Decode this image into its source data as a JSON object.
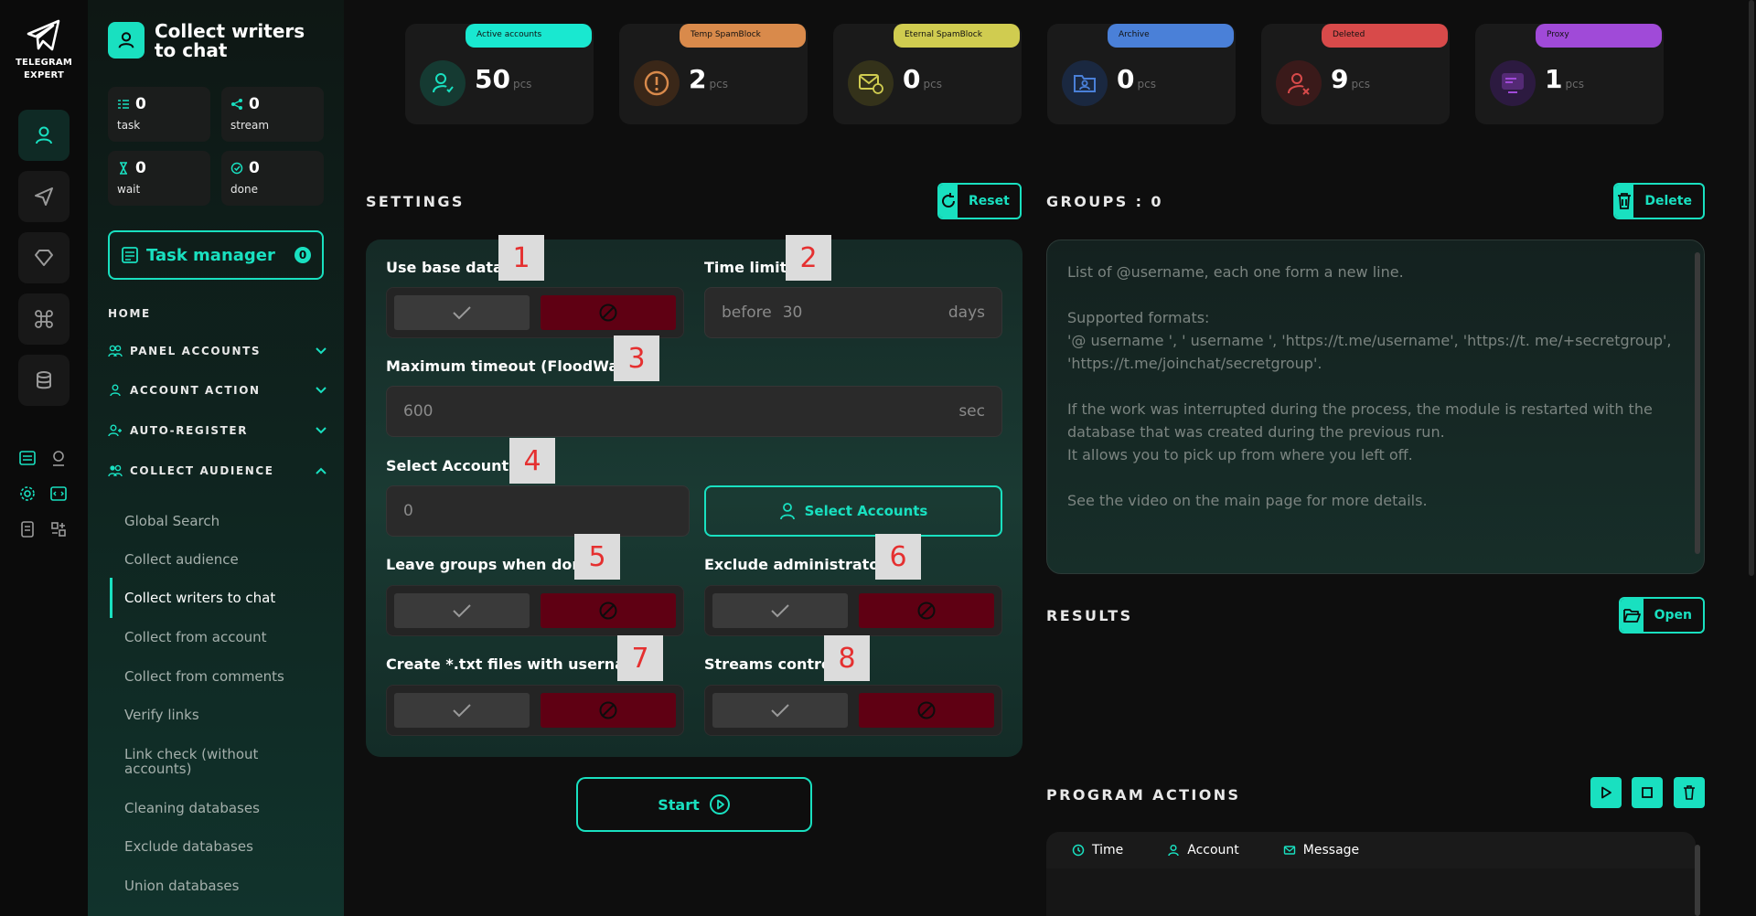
{
  "app": {
    "brand": "TELEGRAM EXPERT",
    "accent": "#19e0c0"
  },
  "sidebar": {
    "title": "Collect writers to chat",
    "stats": [
      {
        "value": "0",
        "label": "task",
        "icon": "task-list-icon"
      },
      {
        "value": "0",
        "label": "stream",
        "icon": "share-icon"
      },
      {
        "value": "0",
        "label": "wait",
        "icon": "hourglass-icon"
      },
      {
        "value": "0",
        "label": "done",
        "icon": "check-circle-icon"
      }
    ],
    "task_manager": {
      "label": "Task manager",
      "badge": "0"
    },
    "home": "HOME",
    "sections": [
      {
        "label": "PANEL ACCOUNTS",
        "icon": "users-icon",
        "expanded": false
      },
      {
        "label": "ACCOUNT ACTION",
        "icon": "user-icon",
        "expanded": false
      },
      {
        "label": "AUTO-REGISTER",
        "icon": "user-plus-icon",
        "expanded": false
      },
      {
        "label": "COLLECT AUDIENCE",
        "icon": "users-icon",
        "expanded": true
      }
    ],
    "sub_items": [
      "Global Search",
      "Collect audience",
      "Collect writers to chat",
      "Collect from account",
      "Collect from comments",
      "Verify links",
      "Link check (without accounts)",
      "Cleaning databases",
      "Exclude databases",
      "Union databases"
    ],
    "active_sub": "Collect writers to chat"
  },
  "top_stats": [
    {
      "label": "Active accounts",
      "value": "50",
      "unit": "pcs",
      "color": "#19e0c0",
      "icon": "user-heart-icon"
    },
    {
      "label": "Temp SpamBlock",
      "value": "2",
      "unit": "pcs",
      "color": "#d98a4b",
      "icon": "warning-icon"
    },
    {
      "label": "Eternal SpamBlock",
      "value": "0",
      "unit": "pcs",
      "color": "#d0cc50",
      "icon": "mail-block-icon"
    },
    {
      "label": "Archive",
      "value": "0",
      "unit": "pcs",
      "color": "#4a80d8",
      "icon": "folder-user-icon"
    },
    {
      "label": "Deleted",
      "value": "9",
      "unit": "pcs",
      "color": "#d84a4a",
      "icon": "user-x-icon"
    },
    {
      "label": "Proxy",
      "value": "1",
      "unit": "pcs",
      "color": "#a04ad8",
      "icon": "proxy-icon"
    }
  ],
  "settings": {
    "title": "SETTINGS",
    "reset_label": "Reset",
    "use_base_data": "Use base data",
    "time_limit": {
      "label": "Time limit",
      "prefix": "before",
      "value": "30",
      "unit": "days"
    },
    "max_timeout": {
      "label": "Maximum timeout (FloodWait)",
      "value": "600",
      "unit": "sec"
    },
    "select_accounts": {
      "label": "Select Accounts",
      "value": "0",
      "button": "Select Accounts"
    },
    "leave_groups": "Leave groups when done",
    "exclude_admins": "Exclude administrators",
    "create_txt": "Create *.txt files with username",
    "streams_control": "Streams control",
    "start_label": "Start",
    "markers": [
      "1",
      "2",
      "3",
      "4",
      "5",
      "6",
      "7",
      "8"
    ]
  },
  "groups": {
    "title": "GROUPS : 0",
    "delete_label": "Delete",
    "placeholder_lines": [
      "List of @username, each one form a new line.",
      "Supported formats:",
      "'@ username ', ' username ', 'https://t.me/username', 'https://t. me/+secretgroup', 'https://t.me/joinchat/secretgroup'.",
      "If the work was interrupted during the process, the module is restarted with the database that was created during the previous run.",
      "It allows you to pick up from where you left off.",
      "See the video on the main page for more details."
    ]
  },
  "results": {
    "title": "RESULTS",
    "open_label": "Open"
  },
  "program_actions": {
    "title": "PROGRAM ACTIONS",
    "columns": [
      "Time",
      "Account",
      "Message"
    ]
  }
}
